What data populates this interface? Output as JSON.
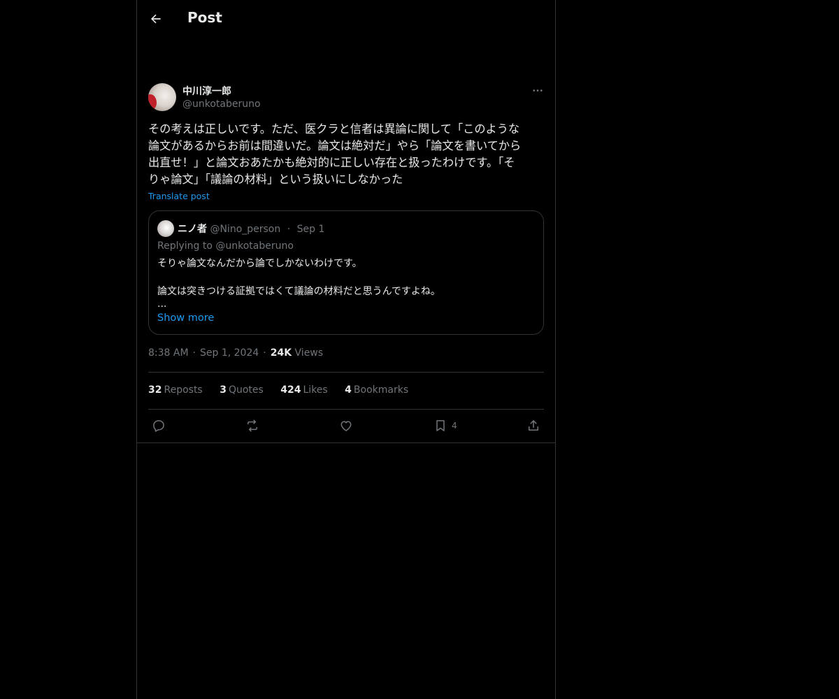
{
  "header": {
    "title": "Post"
  },
  "post": {
    "display_name": "中川淳一郎",
    "handle": "@unkotaberuno",
    "text": "その考えは正しいです。ただ、医クラと信者は異論に関して「このような\n論文があるからお前は間違いだ。論文は絶対だ」やら「論文を書いてから\n出直せ！」と論文おあたかも絶対的に正しい存在と扱ったわけです。「そ\nりゃ論文」「議論の材料」という扱いにしなかった",
    "translate_label": "Translate post",
    "time": "8:38 AM",
    "date": "Sep 1, 2024",
    "views_count": "24K",
    "views_label": "Views"
  },
  "quote": {
    "display_name": "ニノ者",
    "handle": "@Nino_person",
    "separator": "·",
    "date": "Sep 1",
    "replying_prefix": "Replying to",
    "replying_handle": "@unkotaberuno",
    "text": "そりゃ論文なんだから論でしかないわけです。\n\n論文は突きつける証拠ではくて議論の材料だと思うんですよね。",
    "ellipsis": "...",
    "show_more": "Show more"
  },
  "stats": {
    "reposts_count": "32",
    "reposts_label": "Reposts",
    "quotes_count": "3",
    "quotes_label": "Quotes",
    "likes_count": "424",
    "likes_label": "Likes",
    "bookmarks_count": "4",
    "bookmarks_label": "Bookmarks"
  },
  "actions": {
    "bookmark_count": "4"
  },
  "icons": {
    "back": "arrow-left-icon",
    "more": "more-horizontal-icon",
    "reply": "reply-icon",
    "repost": "repost-icon",
    "like": "heart-icon",
    "bookmark": "bookmark-icon",
    "share": "share-icon"
  },
  "colors": {
    "background": "#000000",
    "text_primary": "#e7e9ea",
    "text_secondary": "#71767b",
    "accent": "#1d9bf0",
    "border": "#2f3336"
  }
}
